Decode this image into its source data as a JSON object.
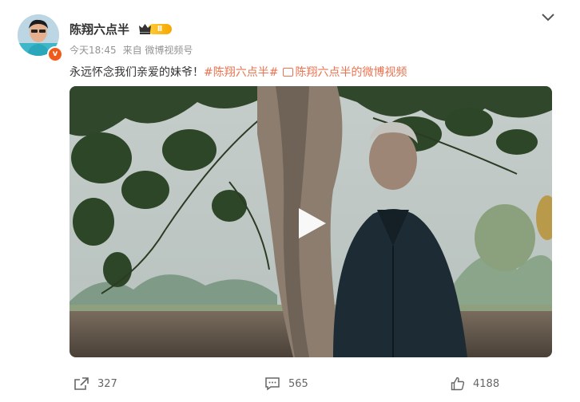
{
  "post": {
    "author": "陈翔六点半",
    "level": "Ⅱ",
    "verified_mark": "v",
    "time": "今天18:45",
    "source": "来自 微博视频号",
    "text": "永远怀念我们亲爱的妹爷！",
    "hashtag": "#陈翔六点半#",
    "link_text": "陈翔六点半的微博视频"
  },
  "actions": {
    "share_count": "327",
    "comment_count": "565",
    "like_count": "4188"
  },
  "colors": {
    "link": "#eb7350",
    "meta_text": "#939393",
    "verified": "#f05a1a",
    "level": "#f7a600"
  },
  "icons": [
    "chevron-down-icon",
    "verified-icon",
    "crown-icon",
    "link-icon",
    "play-icon",
    "share-icon",
    "comment-icon",
    "like-icon"
  ]
}
